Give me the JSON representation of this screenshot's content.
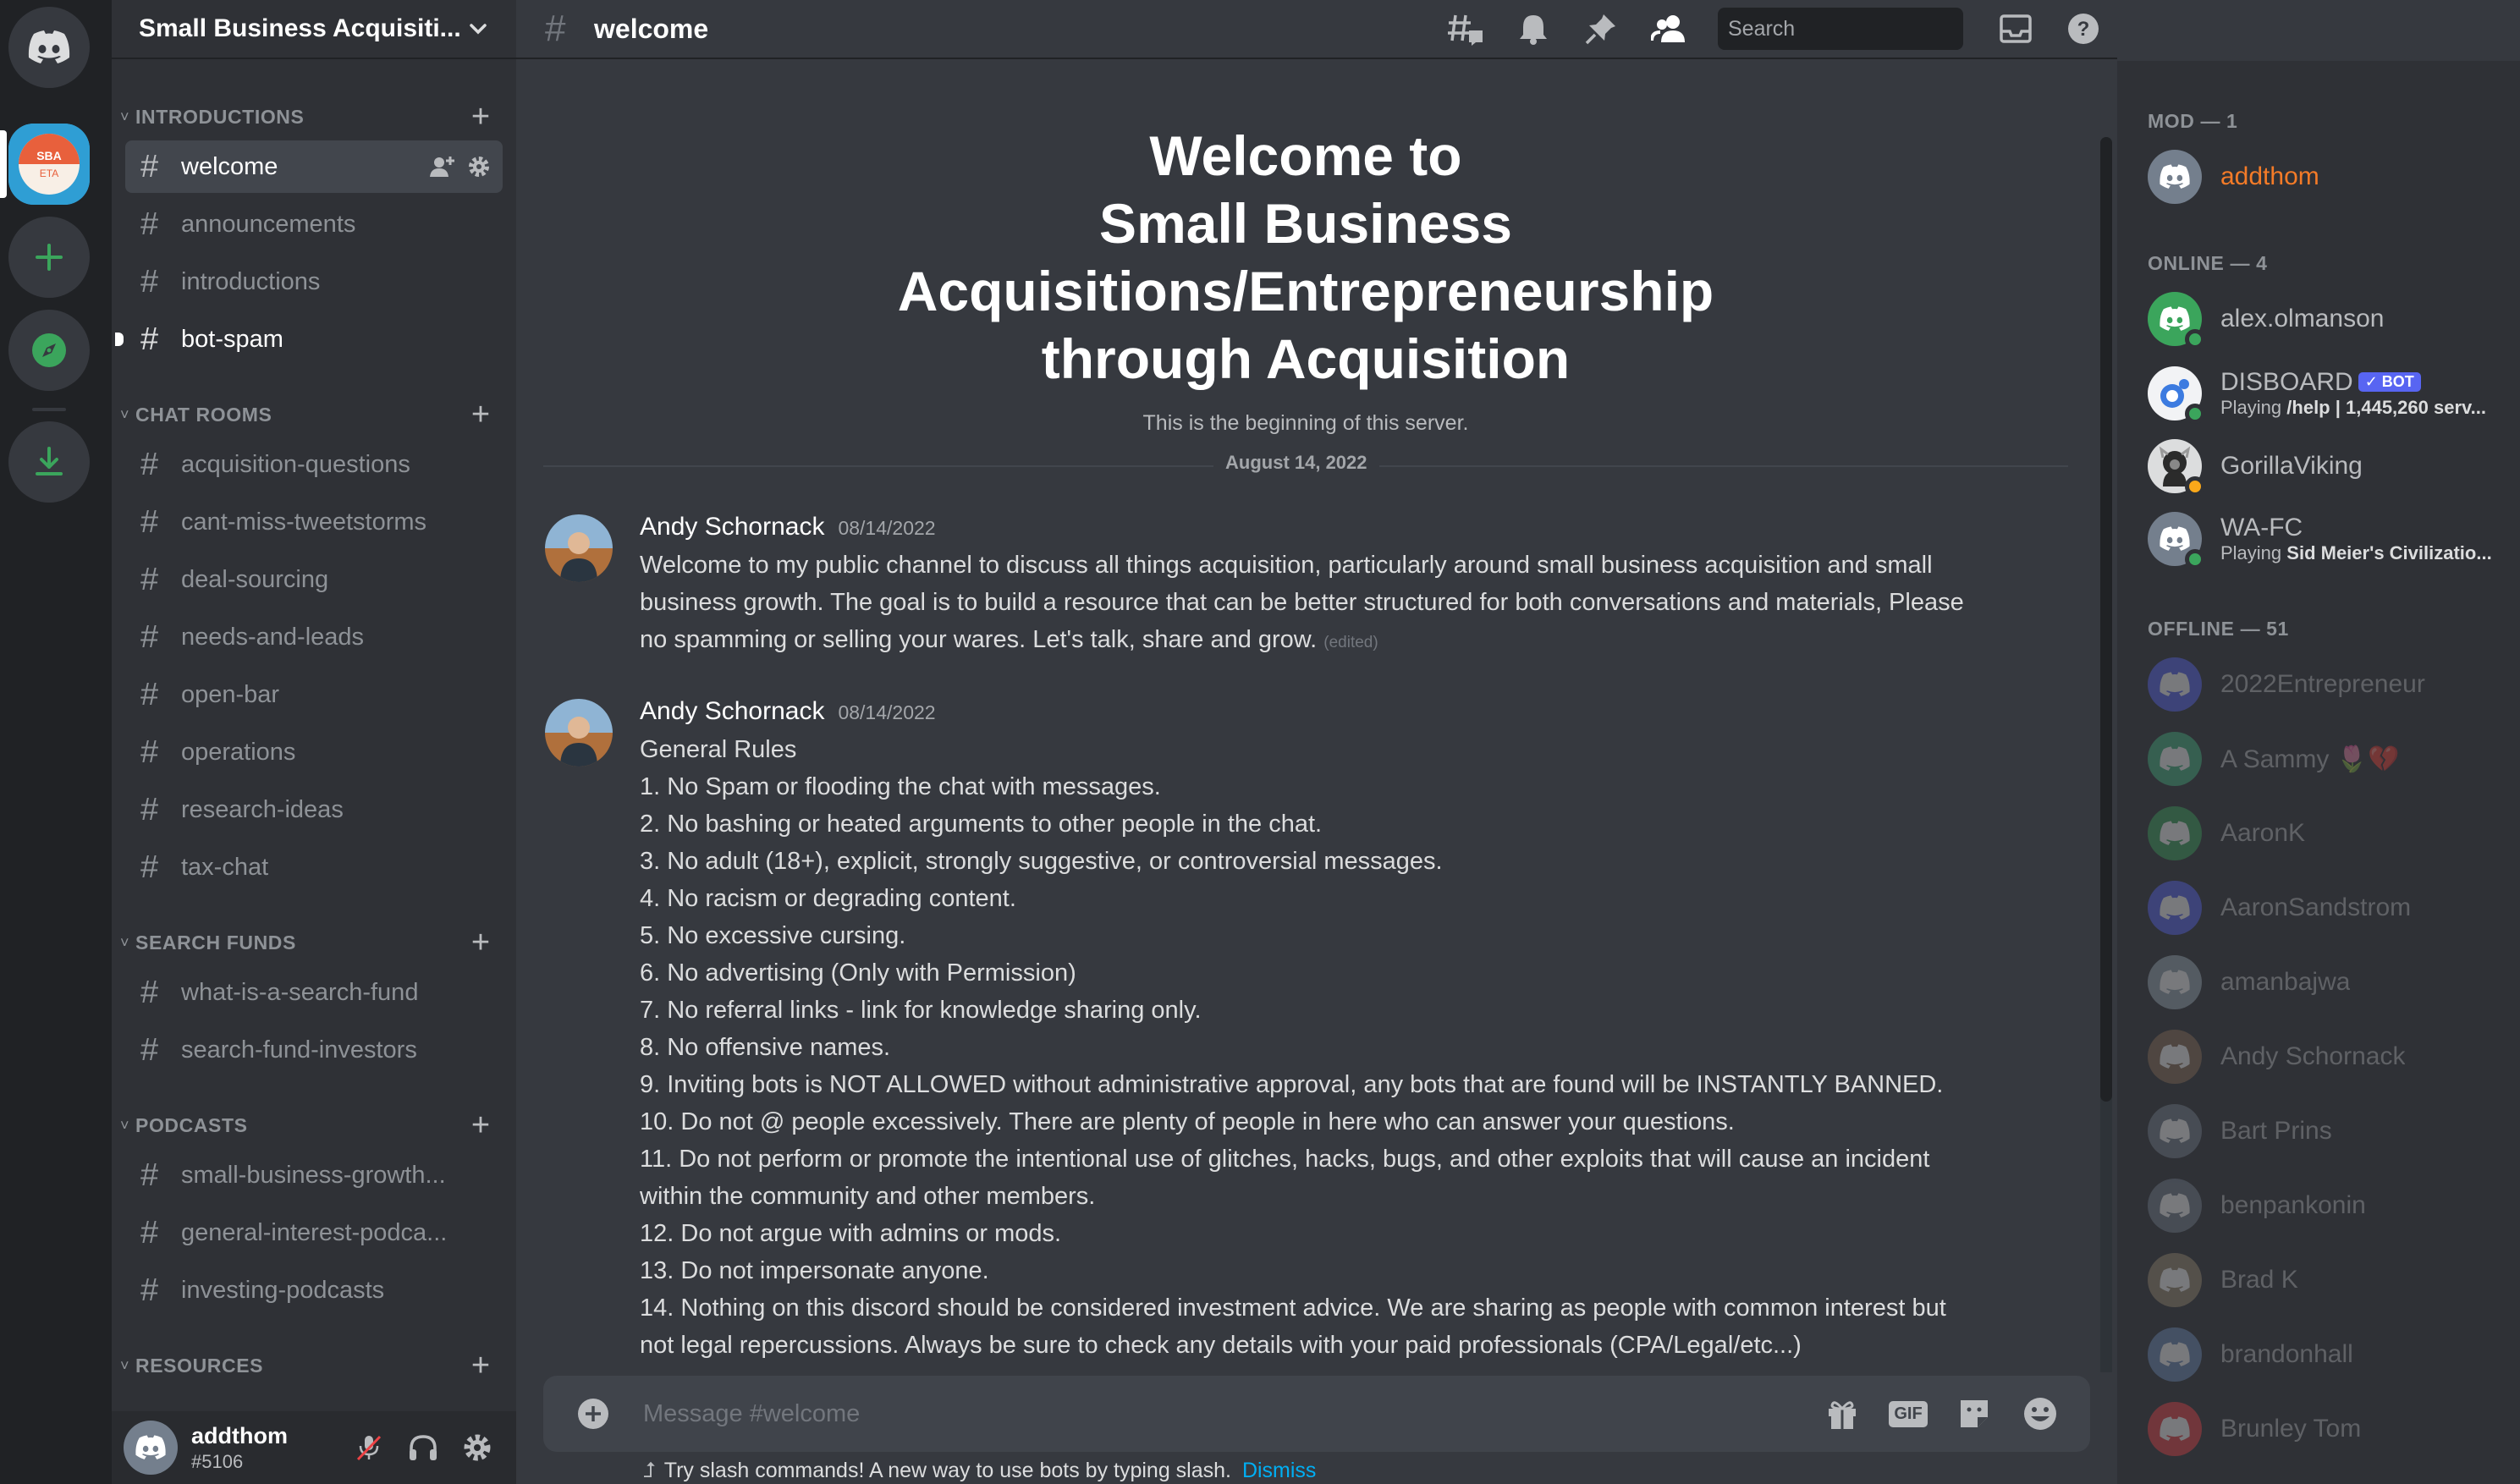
{
  "colors": {
    "blurple": "#5865f2",
    "online": "#3ba55c",
    "idle": "#faa81a",
    "mod_name": "#f47b28",
    "link": "#00aff4"
  },
  "server": {
    "name": "Small Business Acquisiti...",
    "icon_top": "SBA",
    "icon_bottom": "ETA"
  },
  "categories": [
    {
      "label": "INTRODUCTIONS",
      "channels": [
        "welcome",
        "announcements",
        "introductions",
        "bot-spam"
      ]
    },
    {
      "label": "CHAT ROOMS",
      "channels": [
        "acquisition-questions",
        "cant-miss-tweetstorms",
        "deal-sourcing",
        "needs-and-leads",
        "open-bar",
        "operations",
        "research-ideas",
        "tax-chat"
      ]
    },
    {
      "label": "SEARCH FUNDS",
      "channels": [
        "what-is-a-search-fund",
        "search-fund-investors"
      ]
    },
    {
      "label": "PODCASTS",
      "channels": [
        "small-business-growth...",
        "general-interest-podca...",
        "investing-podcasts"
      ]
    },
    {
      "label": "RESOURCES",
      "channels": []
    }
  ],
  "user": {
    "name": "addthom",
    "tag": "#5106"
  },
  "header": {
    "channel": "welcome",
    "search_placeholder": "Search"
  },
  "welcome": {
    "title_lines": [
      "Welcome to",
      "Small Business",
      "Acquisitions/Entrepreneurship",
      "through Acquisition"
    ],
    "subtitle": "This is the beginning of this server.",
    "date": "August 14, 2022"
  },
  "messages": [
    {
      "author": "Andy Schornack",
      "time": "08/14/2022",
      "lines": [
        "Welcome to my public channel to discuss all things acquisition, particularly around small business acquisition and small",
        "business growth.  The goal is to build a resource that can be better structured for both conversations and materials, Please",
        "no spamming or selling your wares. Let's talk, share and grow."
      ],
      "edited": "(edited)"
    },
    {
      "author": "Andy Schornack",
      "time": "08/14/2022",
      "lines": [
        "General Rules",
        "1. No Spam or flooding the chat with messages.",
        "2. No bashing or heated arguments to other people in the chat.",
        "3. No adult (18+), explicit, strongly suggestive, or controversial messages.",
        "4. No racism or degrading content.",
        "5. No excessive cursing.",
        "6. No advertising (Only with Permission)",
        "7. No referral links - link for knowledge sharing only.",
        "8.  No offensive names.",
        "9. Inviting bots is NOT ALLOWED without administrative approval, any bots that are found will be INSTANTLY BANNED.",
        "10. Do not @ people excessively. There are plenty of people in here who can answer your questions.",
        "11. Do not perform or promote the intentional use of glitches, hacks, bugs, and other exploits that will cause an incident",
        "within the community and other members.",
        "12. Do not argue with admins or mods.",
        "13. Do not impersonate anyone.",
        "14. Nothing on this discord should be considered investment advice. We are sharing as people with common interest but",
        "not legal repercussions. Always be sure to check any details with your paid professionals (CPA/Legal/etc...)"
      ]
    }
  ],
  "composer": {
    "placeholder": "Message #welcome",
    "gif_label": "GIF",
    "hint": "Try slash commands! A new way to use bots by typing slash.",
    "dismiss": "Dismiss"
  },
  "members": {
    "groups": [
      {
        "label": "MOD — 1",
        "members": [
          {
            "name": "addthom",
            "status": "none",
            "activity": "",
            "avatar_color": "#747f8d",
            "mod": true
          }
        ]
      },
      {
        "label": "ONLINE — 4",
        "members": [
          {
            "name": "alex.olmanson",
            "status": "online",
            "activity": "",
            "activity_bold": "",
            "avatar_color": "#3ba55c"
          },
          {
            "name": "DISBOARD",
            "bot": "✓ BOT",
            "status": "online",
            "activity": "Playing ",
            "activity_bold": "/help | 1,445,260 serv...",
            "avatar_color": "#f2f3f5"
          },
          {
            "name": "GorillaViking",
            "status": "idle",
            "activity": "",
            "activity_bold": "",
            "avatar_color": "#dcddde"
          },
          {
            "name": "WA-FC",
            "status": "online",
            "activity": "Playing ",
            "activity_bold": "Sid Meier's Civilizatio...",
            "avatar_color": "#747f8d"
          }
        ]
      },
      {
        "label": "OFFLINE — 51",
        "members": [
          {
            "name": "2022Entrepreneur",
            "avatar_color": "#5865f2"
          },
          {
            "name": "A Sammy 🌷💔",
            "avatar_color": "#43b581"
          },
          {
            "name": "AaronK",
            "avatar_color": "#3ba55c"
          },
          {
            "name": "AaronSandstrom",
            "avatar_color": "#5865f2"
          },
          {
            "name": "amanbajwa",
            "avatar_color": "#99aab5"
          },
          {
            "name": "Andy Schornack",
            "avatar_color": "#8b6f56"
          },
          {
            "name": "Bart Prins",
            "avatar_color": "#747f8d"
          },
          {
            "name": "benpankonin",
            "avatar_color": "#747f8d"
          },
          {
            "name": "Brad K",
            "avatar_color": "#9a8a70"
          },
          {
            "name": "brandonhall",
            "avatar_color": "#6b8ab8"
          },
          {
            "name": "Brunley Tom",
            "avatar_color": "#ed4245"
          }
        ]
      }
    ]
  }
}
